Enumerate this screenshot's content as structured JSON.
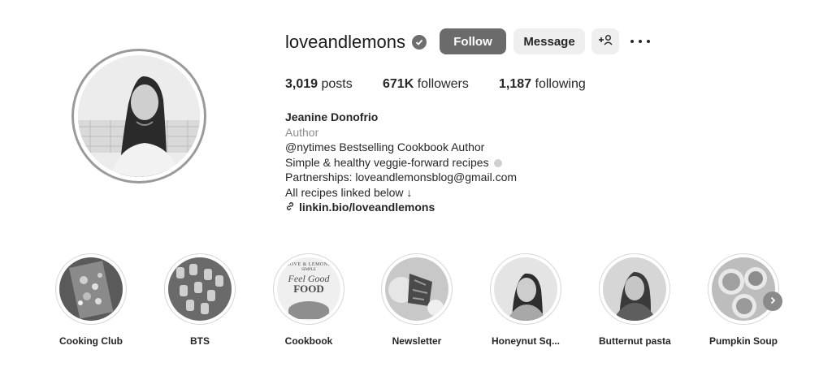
{
  "profile": {
    "username": "loveandlemons",
    "verified": true,
    "avatar_icon": "profile-photo"
  },
  "actions": {
    "follow_label": "Follow",
    "message_label": "Message",
    "add_user_icon": "add-user-icon",
    "more_icon": "more-options-icon"
  },
  "stats": {
    "posts_count": "3,019",
    "posts_label": "posts",
    "followers_count": "671K",
    "followers_label": "followers",
    "following_count": "1,187",
    "following_label": "following"
  },
  "bio": {
    "full_name": "Jeanine Donofrio",
    "category": "Author",
    "lines": [
      "@nytimes Bestselling Cookbook Author",
      "Simple & healthy veggie-forward recipes",
      "Partnerships: loveandlemonsblog@gmail.com",
      "All recipes linked below ↓"
    ],
    "link_text": "linkin.bio/loveandlemons"
  },
  "highlights": [
    {
      "label": "Cooking Club"
    },
    {
      "label": "BTS"
    },
    {
      "label": "Cookbook",
      "cover_lines": [
        "LOVE & LEMONS",
        "SIMPLE",
        "Feel Good",
        "FOOD"
      ]
    },
    {
      "label": "Newsletter"
    },
    {
      "label": "Honeynut Sq..."
    },
    {
      "label": "Butternut pasta"
    },
    {
      "label": "Pumpkin Soup"
    }
  ],
  "colors": {
    "follow_bg": "#6b6b6b",
    "secondary_bg": "#efefef",
    "text": "#262626",
    "muted": "#8e8e8e"
  }
}
